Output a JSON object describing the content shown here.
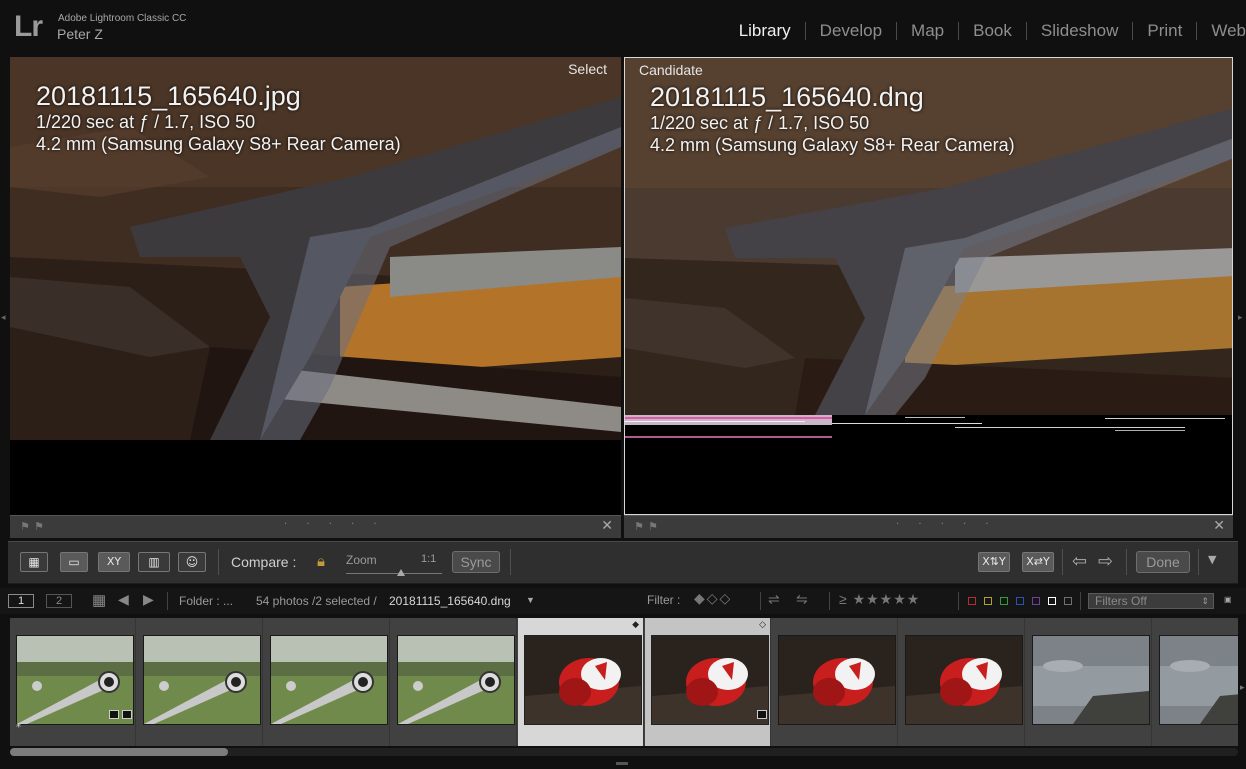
{
  "app": {
    "logo": "Lr",
    "name": "Adobe Lightroom Classic CC",
    "user": "Peter Z"
  },
  "modules": [
    "Library",
    "Develop",
    "Map",
    "Book",
    "Slideshow",
    "Print",
    "Web"
  ],
  "active_module": "Library",
  "select_pane": {
    "tag": "Select",
    "filename": "20181115_165640.jpg",
    "exposure": "1/220 sec at ƒ / 1.7, ISO 50",
    "lens": "4.2 mm (Samsung Galaxy S8+ Rear Camera)"
  },
  "candidate_pane": {
    "tag": "Candidate",
    "filename": "20181115_165640.dng",
    "exposure": "1/220 sec at ƒ / 1.7, ISO 50",
    "lens": "4.2 mm (Samsung Galaxy S8+ Rear Camera)"
  },
  "strip": {
    "dots": "· · · · ·",
    "close": "✕"
  },
  "toolbar": {
    "compare_label": "Compare :",
    "zoom_label": "Zoom",
    "zoom_ratio": "1:1",
    "sync_label": "Sync",
    "done_label": "Done",
    "xy_label": "XY"
  },
  "filmstrip_header": {
    "monitor1": "1",
    "monitor2": "2",
    "folder": "Folder : ...",
    "count": "54 photos /2 selected /",
    "current_file": "20181115_165640.dng",
    "filter_label": "Filter :",
    "filters_value": "Filters Off",
    "stars": "≥ ★★★★★",
    "color_labels": [
      "#b03030",
      "#b0a030",
      "#30a030",
      "#3050b0",
      "#7040a0",
      "#ffffff",
      "#707070"
    ]
  },
  "thumbnails": [
    {
      "scene": "grass",
      "state": "normal",
      "flag": "*"
    },
    {
      "scene": "grass",
      "state": "normal",
      "flag": ""
    },
    {
      "scene": "grass",
      "state": "normal",
      "flag": ""
    },
    {
      "scene": "grass",
      "state": "normal",
      "flag": ""
    },
    {
      "scene": "red",
      "state": "selected",
      "flag": ""
    },
    {
      "scene": "red",
      "state": "selected",
      "flag": ""
    },
    {
      "scene": "red",
      "state": "normal",
      "flag": ""
    },
    {
      "scene": "red",
      "state": "normal",
      "flag": ""
    },
    {
      "scene": "water",
      "state": "normal",
      "flag": ""
    },
    {
      "scene": "water",
      "state": "normal",
      "flag": ""
    }
  ]
}
